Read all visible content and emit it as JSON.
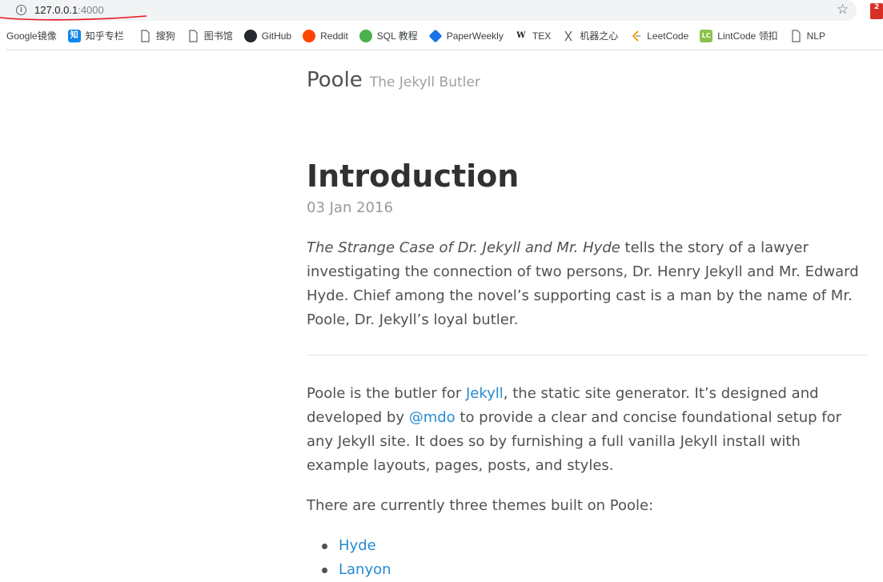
{
  "browser": {
    "url_host": "127.0.0.1",
    "url_port": ":4000",
    "info_icon_glyph": "i",
    "star_icon": "☆",
    "extension_badge": "2"
  },
  "bookmarks": [
    {
      "label": "Google镜像",
      "icon": "google-icon",
      "glyph": "",
      "color": "#ffffff"
    },
    {
      "label": "知乎专栏",
      "icon": "zhihu-icon",
      "glyph": "知",
      "color": "#0f88eb"
    },
    {
      "label": "搜狗",
      "icon": "page-icon",
      "glyph": "",
      "color": "#ffffff"
    },
    {
      "label": "图书馆",
      "icon": "page-icon",
      "glyph": "",
      "color": "#ffffff"
    },
    {
      "label": "GitHub",
      "icon": "github-icon",
      "glyph": "",
      "color": "#24292e"
    },
    {
      "label": "Reddit",
      "icon": "reddit-icon",
      "glyph": "",
      "color": "#ff4500"
    },
    {
      "label": "SQL 教程",
      "icon": "sql-icon",
      "glyph": "",
      "color": "#4caf50"
    },
    {
      "label": "PaperWeekly",
      "icon": "paperweekly-icon",
      "glyph": "",
      "color": "#1a73e8"
    },
    {
      "label": "TEX",
      "icon": "wikipedia-icon",
      "glyph": "W",
      "color": "#ffffff"
    },
    {
      "label": "机器之心",
      "icon": "jiqizhixin-icon",
      "glyph": "",
      "color": "#ffffff"
    },
    {
      "label": "LeetCode",
      "icon": "leetcode-icon",
      "glyph": "",
      "color": "#ffffff"
    },
    {
      "label": "LintCode 领扣",
      "icon": "lintcode-icon",
      "glyph": "LC",
      "color": "#8bc34a"
    },
    {
      "label": "NLP",
      "icon": "page-icon",
      "glyph": "",
      "color": "#ffffff"
    }
  ],
  "site": {
    "title": "Poole",
    "tagline": "The Jekyll Butler"
  },
  "post": {
    "title": "Introduction",
    "date": "03 Jan 2016",
    "p1_em": "The Strange Case of Dr. Jekyll and Mr. Hyde",
    "p1_rest": " tells the story of a lawyer investigating the connection of two persons, Dr. Henry Jekyll and Mr. Edward Hyde. Chief among the novel’s supporting cast is a man by the name of Mr. Poole, Dr. Jekyll’s loyal butler.",
    "p2_a": "Poole is the butler for ",
    "p2_link1": "Jekyll",
    "p2_b": ", the static site generator. It’s designed and developed by ",
    "p2_link2": "@mdo",
    "p2_c": " to provide a clear and concise foundational setup for any Jekyll site. It does so by furnishing a full vanilla Jekyll install with example layouts, pages, posts, and styles.",
    "p3": "There are currently three themes built on Poole:",
    "themes": [
      "Hyde",
      "Lanyon"
    ]
  },
  "colors": {
    "link": "#268bd2",
    "annotation": "#e8141c"
  }
}
